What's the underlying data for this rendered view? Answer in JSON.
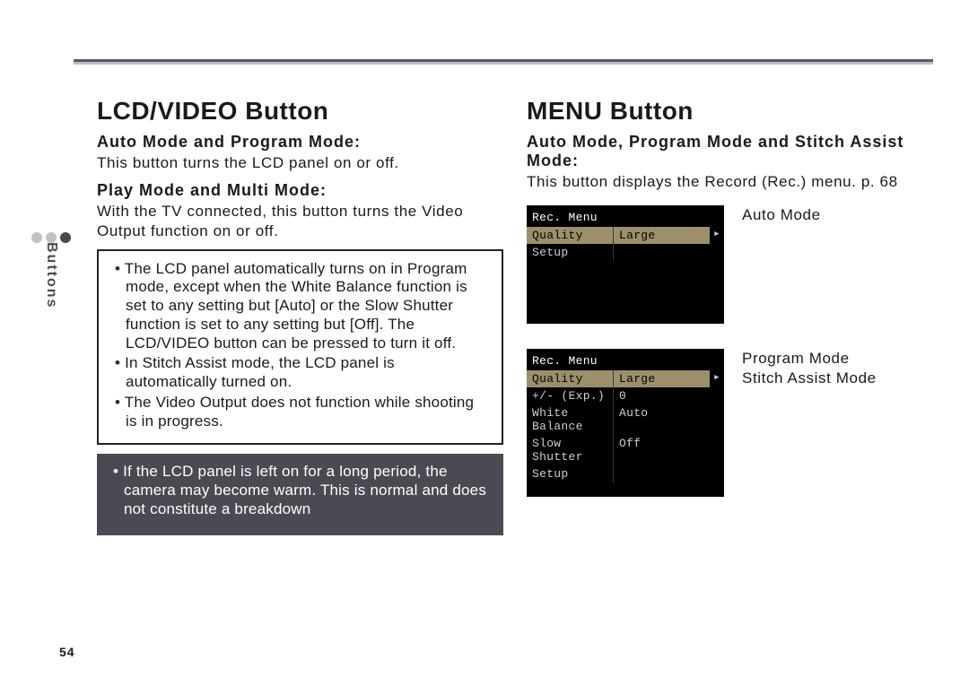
{
  "pageNumber": "54",
  "sideTab": "Buttons",
  "left": {
    "heading": "LCD/VIDEO Button",
    "sec1_title": "Auto Mode and Program Mode:",
    "sec1_body": "This button turns the LCD panel on or off.",
    "sec2_title": "Play Mode and Multi Mode:",
    "sec2_body": "With the TV connected, this button turns the Video Output function on or off.",
    "box_items": [
      "The LCD panel automatically turns on in Program mode, except when the White Balance function is set to any setting but [Auto] or the Slow Shutter function is set to any setting but [Off]. The LCD/VIDEO button can be pressed to turn it off.",
      "In Stitch Assist mode, the LCD panel is automatically turned on.",
      "The Video Output does not function while shooting is in progress."
    ],
    "warn_items": [
      "If the LCD panel is left on for a long period, the camera may become warm. This is normal and does not constitute a breakdown"
    ]
  },
  "right": {
    "heading": "MENU Button",
    "sec1_title": "Auto Mode, Program Mode and Stitch Assist Mode:",
    "sec1_body": "This button displays the Record (Rec.) menu. p. 68",
    "auto_menu": {
      "title": "Rec. Menu",
      "rows": [
        {
          "k": "Quality",
          "v": "Large",
          "hilite": true,
          "arrow": true
        },
        {
          "k": "Setup",
          "v": "",
          "hilite": false
        }
      ],
      "label": "Auto Mode"
    },
    "prog_menu": {
      "title": "Rec. Menu",
      "rows": [
        {
          "k": "Quality",
          "v": "Large",
          "hilite": true,
          "arrow": true
        },
        {
          "k": "+/- (Exp.)",
          "v": "0",
          "hilite": false
        },
        {
          "k": "White Balance",
          "v": "Auto",
          "hilite": false
        },
        {
          "k": "Slow Shutter",
          "v": "Off",
          "hilite": false
        },
        {
          "k": "Setup",
          "v": "",
          "hilite": false
        }
      ],
      "label1": "Program Mode",
      "label2": "Stitch Assist Mode"
    }
  }
}
